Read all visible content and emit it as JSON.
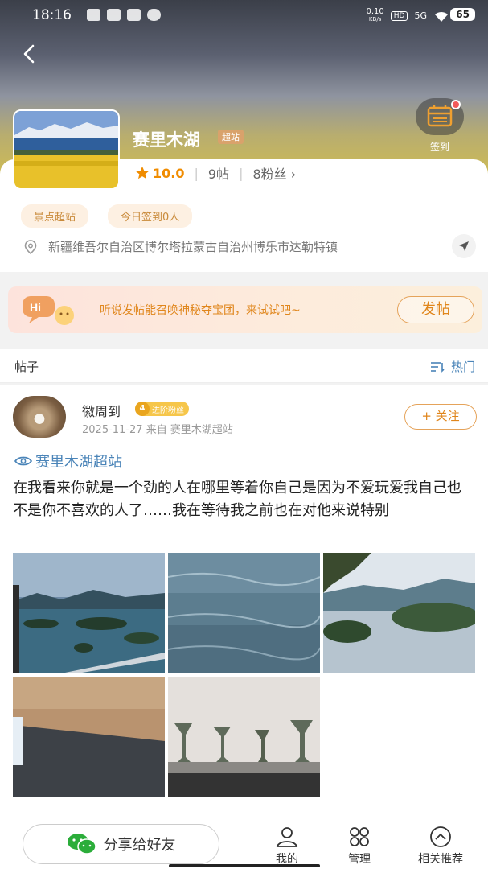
{
  "status_bar": {
    "time": "18:16",
    "speed": "0.10",
    "speed_unit": "KB/s",
    "hd": "HD",
    "network": "5G",
    "battery": "65"
  },
  "header": {
    "title": "赛里木湖",
    "super_badge": "超站",
    "checkin_label": "签到",
    "rating": "10.0",
    "posts_count": "9帖",
    "fans_count": "8粉丝",
    "fans_chevron": "›"
  },
  "tags": [
    "景点超站",
    "今日签到0人"
  ],
  "location": "新疆维吾尔自治区博尔塔拉蒙古自治州博乐市达勒特镇",
  "promo": {
    "hi": "Hi",
    "text": "听说发帖能召唤神秘夺宝团，来试试吧~",
    "button": "发帖"
  },
  "posts_section": {
    "label": "帖子",
    "sort": "热门"
  },
  "post": {
    "author": "徽周到",
    "fan_level": "4",
    "fan_badge": "进阶粉丝",
    "date": "2025-11-27",
    "source": "来自 赛里木湖超站",
    "follow": "+ 关注",
    "topic": "赛里木湖超站",
    "content": "在我看来你就是一个劲的人在哪里等着你自己是因为不爱玩爱我自己也不是你不喜欢的人了……我在等待我之前也在对他来说特别"
  },
  "bottom_bar": {
    "share": "分享给好友",
    "mine": "我的",
    "manage": "管理",
    "related": "相关推荐"
  },
  "colors": {
    "accent": "#e0861c",
    "link": "#4a84b8",
    "rating": "#f08c00"
  },
  "icons": [
    "back-arrow-icon",
    "calendar-icon",
    "star-icon",
    "location-pin-icon",
    "navigation-arrow-icon",
    "sort-icon",
    "eye-icon",
    "wechat-icon",
    "person-icon",
    "grid-icon",
    "chevron-up-icon"
  ]
}
